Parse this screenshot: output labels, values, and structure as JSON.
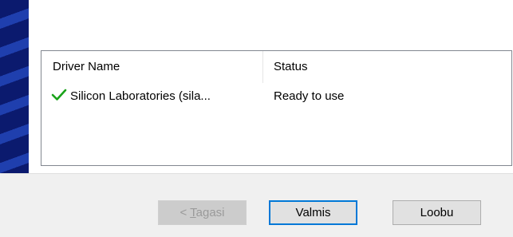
{
  "driver_list": {
    "columns": {
      "name": "Driver Name",
      "status": "Status"
    },
    "rows": [
      {
        "icon": "checkmark-icon",
        "name": "Silicon Laboratories (sila...",
        "status": "Ready to use"
      }
    ]
  },
  "buttons": {
    "back": {
      "prefix": "< ",
      "mnemonic": "T",
      "rest": "agasi",
      "enabled": false
    },
    "finish": {
      "label": "Valmis"
    },
    "cancel": {
      "label": "Loobu"
    }
  },
  "colors": {
    "check": "#1aa31a",
    "accent_border": "#0078d7",
    "banner_dark": "#0b1a6e",
    "banner_light": "#1f3fae"
  }
}
